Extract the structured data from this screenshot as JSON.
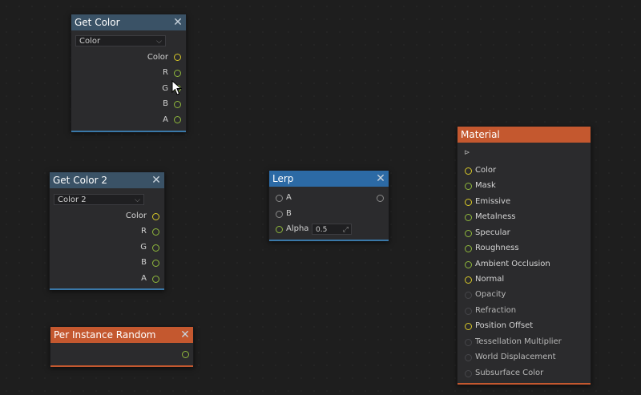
{
  "nodes": {
    "get_color": {
      "title": "Get Color",
      "dropdown": "Color",
      "outputs": [
        "Color",
        "R",
        "G",
        "B",
        "A"
      ]
    },
    "get_color_2": {
      "title": "Get Color 2",
      "dropdown": "Color 2",
      "outputs": [
        "Color",
        "R",
        "G",
        "B",
        "A"
      ]
    },
    "per_instance_random": {
      "title": "Per Instance Random"
    },
    "lerp": {
      "title": "Lerp",
      "inputs": [
        "A",
        "B",
        "Alpha"
      ],
      "alpha_value": "0.5"
    },
    "material": {
      "title": "Material",
      "exec_glyph": "⊳",
      "inputs": [
        "Color",
        "Mask",
        "Emissive",
        "Metalness",
        "Specular",
        "Roughness",
        "Ambient Occlusion",
        "Normal",
        "Opacity",
        "Refraction",
        "Position Offset",
        "Tessellation Multiplier",
        "World Displacement",
        "Subsurface Color"
      ]
    }
  },
  "icons": {
    "close": "✕",
    "chevron": "⌵",
    "resize": "⤢"
  },
  "colors": {
    "header_blue": "#3a5266",
    "header_lerp": "#2c6aa5",
    "header_orange": "#c4582f",
    "pin_yellow": "#d8c828",
    "pin_green": "#8fb83c"
  }
}
